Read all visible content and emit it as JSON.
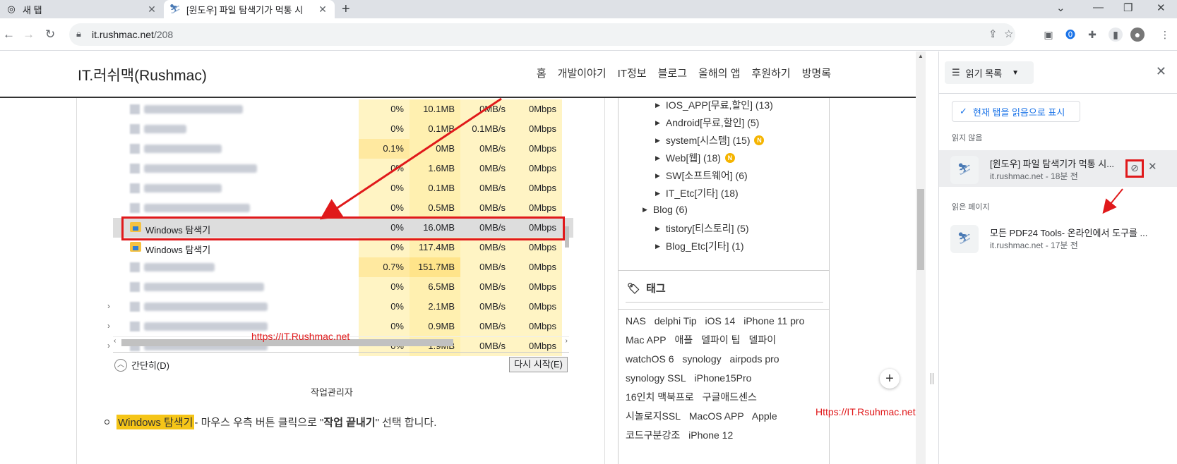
{
  "browser": {
    "tabs": [
      {
        "title": "새 탭",
        "icon": "chrome-icon"
      },
      {
        "title": "[윈도우] 파일 탐색기가 먹통 시",
        "icon": "site-favicon"
      }
    ],
    "url_host": "it.rushmac.net",
    "url_path": "/208"
  },
  "site": {
    "title": "IT.러쉬맥(Rushmac)",
    "nav": [
      "홈",
      "개발이야기",
      "IT정보",
      "블로그",
      "올해의 앱",
      "후원하기",
      "방명록"
    ]
  },
  "taskmgr": {
    "rows": [
      {
        "name": "",
        "cpu": "0%",
        "mem": "10.1MB",
        "disk": "0MB/s",
        "net": "0Mbps"
      },
      {
        "name": "",
        "cpu": "0%",
        "mem": "0.1MB",
        "disk": "0.1MB/s",
        "net": "0Mbps"
      },
      {
        "name": "",
        "cpu": "0.1%",
        "mem": "0MB",
        "disk": "0MB/s",
        "net": "0Mbps"
      },
      {
        "name": "",
        "cpu": "0%",
        "mem": "1.6MB",
        "disk": "0MB/s",
        "net": "0Mbps"
      },
      {
        "name": "",
        "cpu": "0%",
        "mem": "0.1MB",
        "disk": "0MB/s",
        "net": "0Mbps"
      },
      {
        "name": "",
        "cpu": "0%",
        "mem": "0.5MB",
        "disk": "0MB/s",
        "net": "0Mbps"
      },
      {
        "name": "Windows 탐색기",
        "cpu": "0%",
        "mem": "16.0MB",
        "disk": "0MB/s",
        "net": "0Mbps"
      },
      {
        "name": "Windows 탐색기",
        "cpu": "0%",
        "mem": "117.4MB",
        "disk": "0MB/s",
        "net": "0Mbps"
      },
      {
        "name": "",
        "cpu": "0.7%",
        "mem": "151.7MB",
        "disk": "0MB/s",
        "net": "0Mbps"
      },
      {
        "name": "",
        "cpu": "0%",
        "mem": "6.5MB",
        "disk": "0MB/s",
        "net": "0Mbps"
      },
      {
        "name": "",
        "cpu": "0%",
        "mem": "2.1MB",
        "disk": "0MB/s",
        "net": "0Mbps"
      },
      {
        "name": "",
        "cpu": "0%",
        "mem": "0.9MB",
        "disk": "0MB/s",
        "net": "0Mbps"
      },
      {
        "name": "",
        "cpu": "0%",
        "mem": "1.9MB",
        "disk": "0MB/s",
        "net": "0Mbps"
      }
    ],
    "watermark": "https://IT.Rushmac.net",
    "simple_label": "간단히(D)",
    "restart_label": "다시 시작(E)",
    "caption": "작업관리자"
  },
  "article": {
    "highlight": "Windows 탐색기",
    "text1": " - 마우스 우측 버튼 클릭으로 \"",
    "bold": "작업 끝내기",
    "text2": "\" 선택 합니다."
  },
  "categories": [
    {
      "label": "IOS_APP[무료,할인]",
      "count": "(13)",
      "new": false
    },
    {
      "label": "Android[무료,할인]",
      "count": "(5)",
      "new": false
    },
    {
      "label": "system[시스템]",
      "count": "(15)",
      "new": true
    },
    {
      "label": "Web[웹]",
      "count": "(18)",
      "new": true
    },
    {
      "label": "SW[소프트웨어]",
      "count": "(6)",
      "new": false
    },
    {
      "label": "IT_Etc[기타]",
      "count": "(18)",
      "new": false
    },
    {
      "label": "Blog",
      "count": "(6)",
      "new": false
    },
    {
      "label": "tistory[티스토리]",
      "count": "(5)",
      "new": false
    },
    {
      "label": "Blog_Etc[기타]",
      "count": "(1)",
      "new": false
    }
  ],
  "new_badge": "N",
  "tags": {
    "title": "태그",
    "items": [
      "NAS",
      "delphi Tip",
      "iOS 14",
      "iPhone 11 pro",
      "Mac APP",
      "애플",
      "델파이 팁",
      "델파이",
      "watchOS 6",
      "synology",
      "airpods pro",
      "synology SSL",
      "iPhone15Pro",
      "16인치 맥북프로",
      "구글애드센스",
      "시놀로지SSL",
      "MacOS APP",
      "Apple",
      "코드구분강조",
      "iPhone 12"
    ]
  },
  "watermark2": "Https://IT.Rsuhmac.net",
  "reading_list": {
    "header": "읽기 목록",
    "add_label": "현재 탭을 읽음으로 표시",
    "unread_label": "읽지 않음",
    "read_label": "읽은 페이지",
    "unread": [
      {
        "title": "[윈도우] 파일 탐색기가 먹통 시...",
        "sub": "it.rushmac.net - 18분 전"
      }
    ],
    "read": [
      {
        "title": "모든 PDF24 Tools- 온라인에서 도구를 ...",
        "sub": "it.rushmac.net - 17분 전"
      }
    ]
  }
}
